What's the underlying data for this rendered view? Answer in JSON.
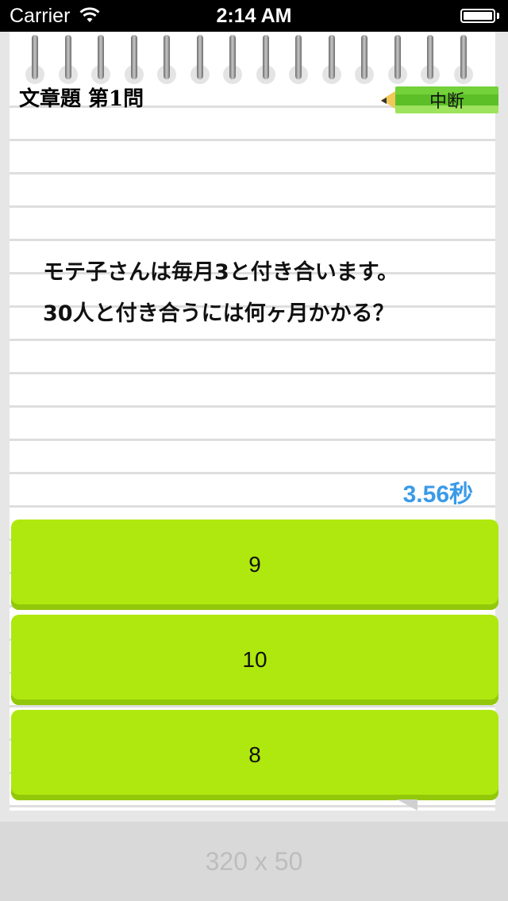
{
  "status_bar": {
    "carrier": "Carrier",
    "time": "2:14 AM"
  },
  "header": {
    "title": "文章題 第1問",
    "pause_label": "中断"
  },
  "question": {
    "line1": "モテ子さんは毎月3と付き合います。",
    "line2": "30人と付き合うには何ヶ月かかる？"
  },
  "timer": "3.56秒",
  "answers": [
    "9",
    "10",
    "8"
  ],
  "ad": {
    "label": "320 x 50"
  },
  "colors": {
    "answer_button": "#aee80e",
    "timer_text": "#3a9ae8",
    "pause_button": "#5cbf28"
  }
}
